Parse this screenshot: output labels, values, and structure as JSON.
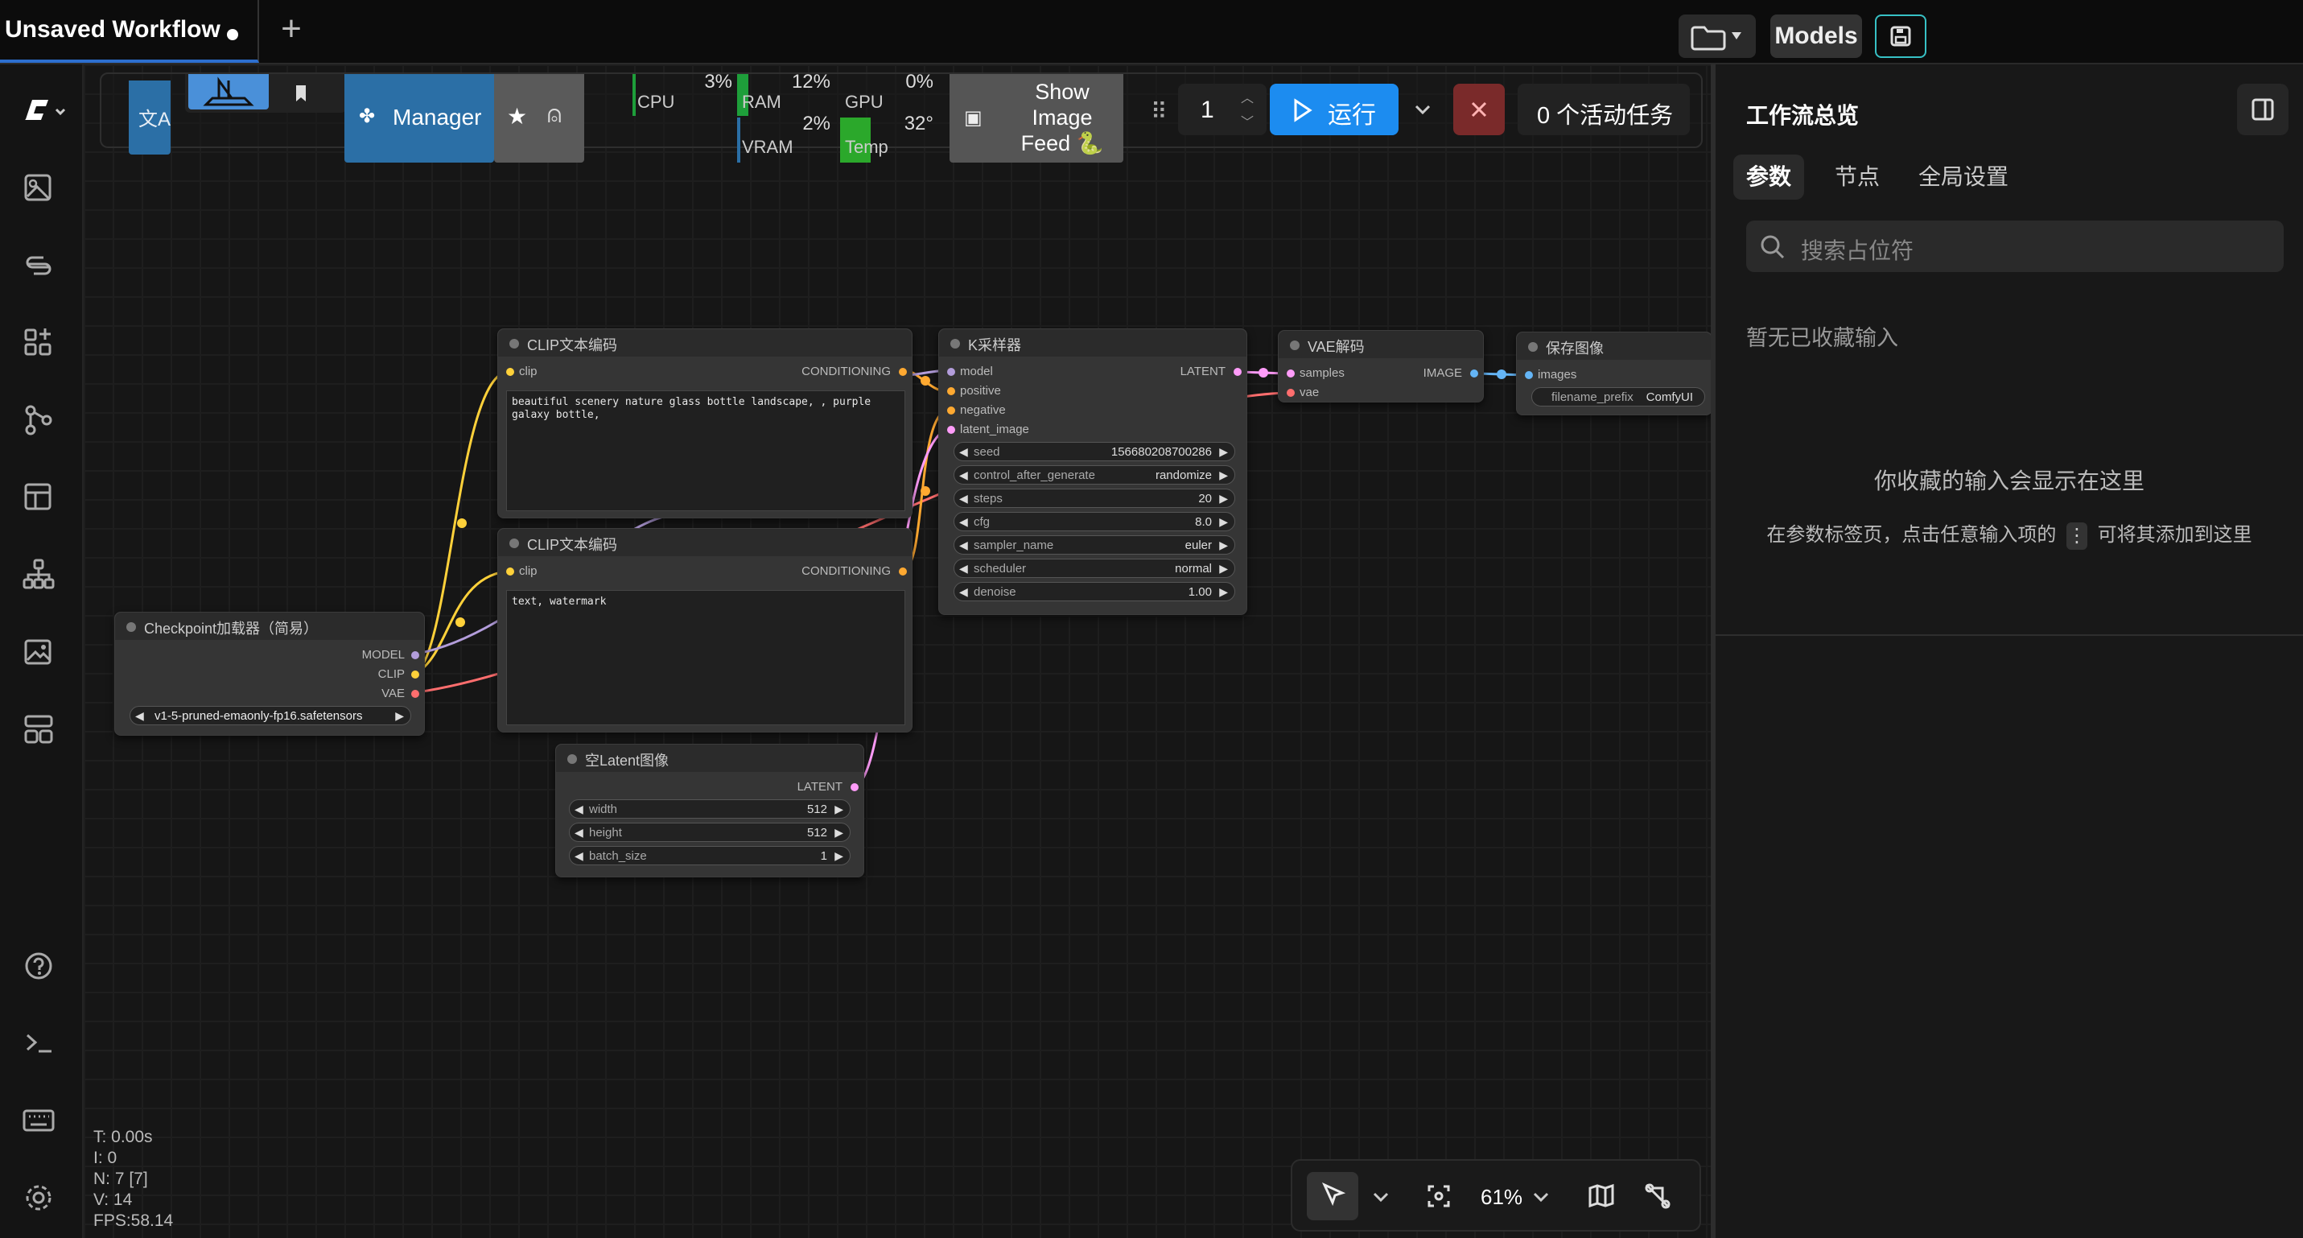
{
  "header": {
    "workflow_tab": "Unsaved Workflow",
    "models_label": "Models"
  },
  "toolbar": {
    "manager_label": "Manager",
    "monitors": {
      "cpu": {
        "label": "CPU",
        "value": "3%"
      },
      "ram": {
        "label": "RAM",
        "value": "12%"
      },
      "gpu": {
        "label": "GPU",
        "value": "0%"
      },
      "vram": {
        "label": "VRAM",
        "value": "2%"
      },
      "temp": {
        "label": "Temp",
        "value": "32°"
      }
    },
    "show_image_feed_label": "Show Image Feed 🐍",
    "queue_count": "1",
    "run_label": "运行",
    "active_tasks_label": "0 个活动任务"
  },
  "nodes": {
    "clip_text_1": {
      "title": "CLIP文本编码",
      "input_clip": "clip",
      "output_conditioning": "CONDITIONING",
      "text": "beautiful scenery nature glass bottle landscape, , purple galaxy bottle,"
    },
    "clip_text_2": {
      "title": "CLIP文本编码",
      "input_clip": "clip",
      "output_conditioning": "CONDITIONING",
      "text": "text, watermark"
    },
    "checkpoint": {
      "title": "Checkpoint加载器（简易）",
      "out_model": "MODEL",
      "out_clip": "CLIP",
      "out_vae": "VAE",
      "ckpt_name": "v1-5-pruned-emaonly-fp16.safetensors"
    },
    "ksampler": {
      "title": "K采样器",
      "in_model": "model",
      "in_positive": "positive",
      "in_negative": "negative",
      "in_latent": "latent_image",
      "out_latent": "LATENT",
      "widgets": [
        {
          "label": "seed",
          "value": "156680208700286"
        },
        {
          "label": "control_after_generate",
          "value": "randomize"
        },
        {
          "label": "steps",
          "value": "20"
        },
        {
          "label": "cfg",
          "value": "8.0"
        },
        {
          "label": "sampler_name",
          "value": "euler"
        },
        {
          "label": "scheduler",
          "value": "normal"
        },
        {
          "label": "denoise",
          "value": "1.00"
        }
      ]
    },
    "vae_decode": {
      "title": "VAE解码",
      "in_samples": "samples",
      "in_vae": "vae",
      "out_image": "IMAGE"
    },
    "save_image": {
      "title": "保存图像",
      "in_images": "images",
      "prefix_label": "filename_prefix",
      "prefix_value": "ComfyUI"
    },
    "empty_latent": {
      "title": "空Latent图像",
      "out_latent": "LATENT",
      "widgets": [
        {
          "label": "width",
          "value": "512"
        },
        {
          "label": "height",
          "value": "512"
        },
        {
          "label": "batch_size",
          "value": "1"
        }
      ]
    }
  },
  "right_panel": {
    "title": "工作流总览",
    "tabs": [
      "参数",
      "节点",
      "全局设置"
    ],
    "search_placeholder": "搜索占位符",
    "section_label": "暂无已收藏输入",
    "empty_title": "你收藏的输入会显示在这里",
    "empty_desc_before": "在参数标签页，点击任意输入项的",
    "empty_desc_after": "可将其添加到这里"
  },
  "canvas_tools": {
    "zoom": "61%"
  },
  "stats": {
    "t": "T: 0.00s",
    "i": "I: 0",
    "n": "N: 7 [7]",
    "v": "V: 14",
    "fps": "FPS:58.14"
  },
  "colors": {
    "accent_blue": "#1c8cf0",
    "clip_yellow": "#ffd13a",
    "model_lavender": "#b39ddb",
    "vae_red": "#ff6e6e",
    "latent_pink": "#ff9cf9",
    "conditioning_orange": "#ffa931",
    "image_blue": "#64b5f6",
    "cancel_red": "#7a2a2a"
  }
}
